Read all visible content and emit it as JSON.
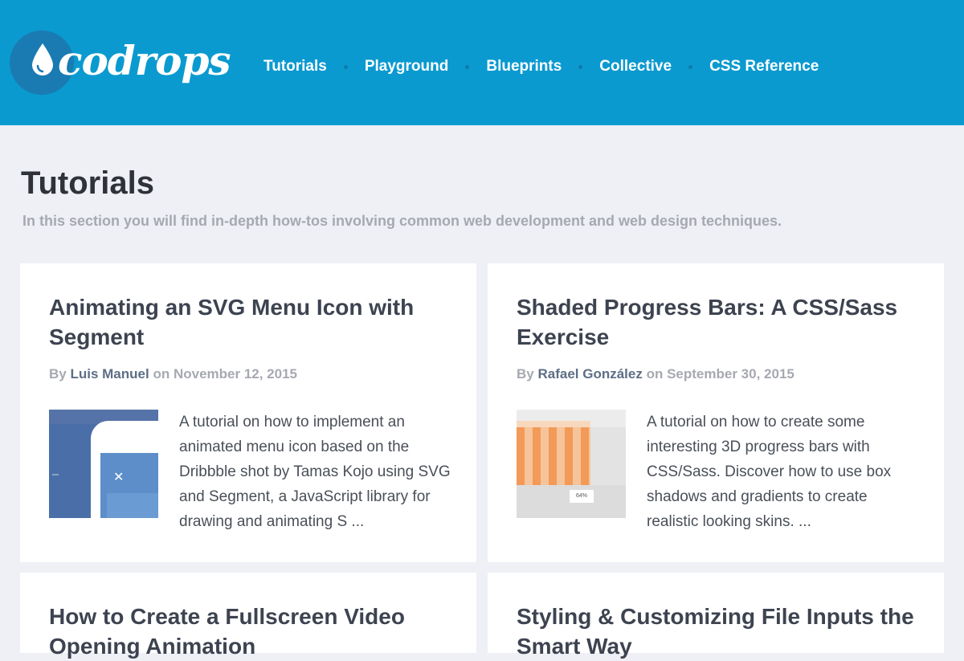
{
  "header": {
    "logo_text": "codrops",
    "nav": [
      "Tutorials",
      "Playground",
      "Blueprints",
      "Collective",
      "CSS Reference"
    ]
  },
  "page": {
    "title": "Tutorials",
    "subtitle": "In this section you will find in-depth how-tos involving common web development and web design techniques."
  },
  "cards": [
    {
      "title": "Animating an SVG Menu Icon with Segment",
      "by": "By",
      "author": "Luis Manuel",
      "on": "on",
      "date": "November 12, 2015",
      "excerpt": "A tutorial on how to implement an animated menu icon based on the Dribbble shot by Tamas Kojo using SVG and Segment, a JavaScript library for drawing and animating S ...",
      "thumb_glyph": "✕"
    },
    {
      "title": "Shaded Progress Bars: A CSS/Sass Exercise",
      "by": "By",
      "author": "Rafael González",
      "on": "on",
      "date": "September 30, 2015",
      "excerpt": "A tutorial on how to create some interesting 3D progress bars with CSS/Sass. Discover how to use box shadows and gradients to create realistic looking skins. ...",
      "thumb_label": "64%"
    },
    {
      "title": "How to Create a Fullscreen Video Opening Animation"
    },
    {
      "title": "Styling & Customizing File Inputs the Smart Way"
    }
  ],
  "colors": {
    "header_bg": "#0a9ad0",
    "page_bg": "#eef0f5",
    "title": "#3d4350",
    "muted": "#a6a9b0",
    "author": "#5d6e86"
  }
}
